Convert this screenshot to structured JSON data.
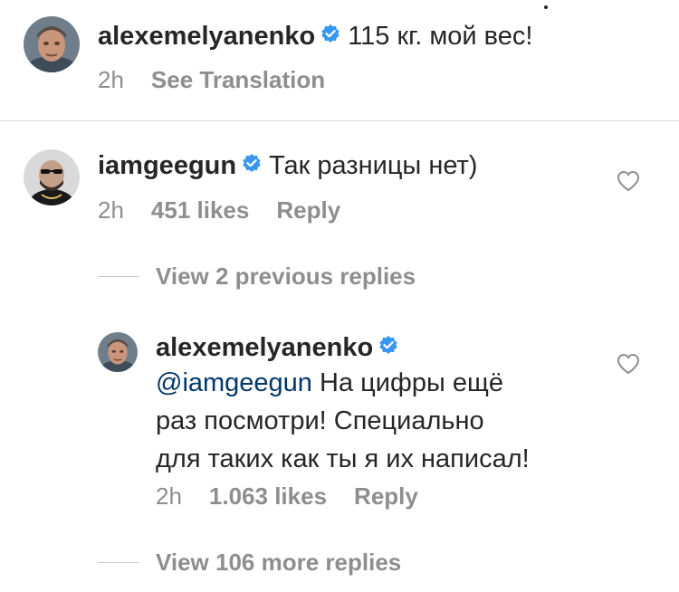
{
  "comments": [
    {
      "username": "alexemelyanenko",
      "text": "115 кг. мой вес!",
      "time": "2h",
      "see_translation": "See Translation"
    },
    {
      "username": "iamgeegun",
      "text": "Так разницы нет)",
      "time": "2h",
      "likes": "451 likes",
      "reply": "Reply"
    }
  ],
  "view_previous": "View 2 previous replies",
  "reply_comment": {
    "username": "alexemelyanenko",
    "mention": "@iamgeegun",
    "text_line1": "На цифры ещё",
    "text_line2": "раз посмотри! Специально",
    "text_line3": "для таких как ты я их написал!",
    "time": "2h",
    "likes": "1.063 likes",
    "reply": "Reply"
  },
  "view_more": "View 106 more replies",
  "icons": {
    "verified": "verified-badge-icon",
    "heart": "heart-outline-icon"
  },
  "colors": {
    "verified": "#3897f0",
    "mention": "#00376b",
    "meta": "#8e8e8e"
  }
}
